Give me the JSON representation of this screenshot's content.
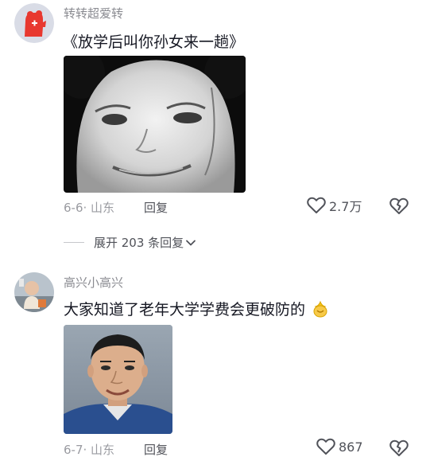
{
  "comments": [
    {
      "username": "转转超爱转",
      "text": "《放学后叫你孙女来一趟》",
      "date": "6-6",
      "location": "· 山东",
      "reply_label": "回复",
      "likes": "2.7万"
    },
    {
      "username": "高兴小高兴",
      "text": "大家知道了老年大学学费会更破防的",
      "date": "6-7",
      "location": "· 山东",
      "reply_label": "回复",
      "likes": "867"
    }
  ],
  "expand_replies": {
    "label": "展开 203 条回复"
  },
  "colors": {
    "muted": "#8a8b91",
    "text": "#161823",
    "icon": "#505259"
  },
  "icons": [
    "heart-icon",
    "broken-heart-icon",
    "chevron-down-icon",
    "sparkle-emoji-icon"
  ]
}
